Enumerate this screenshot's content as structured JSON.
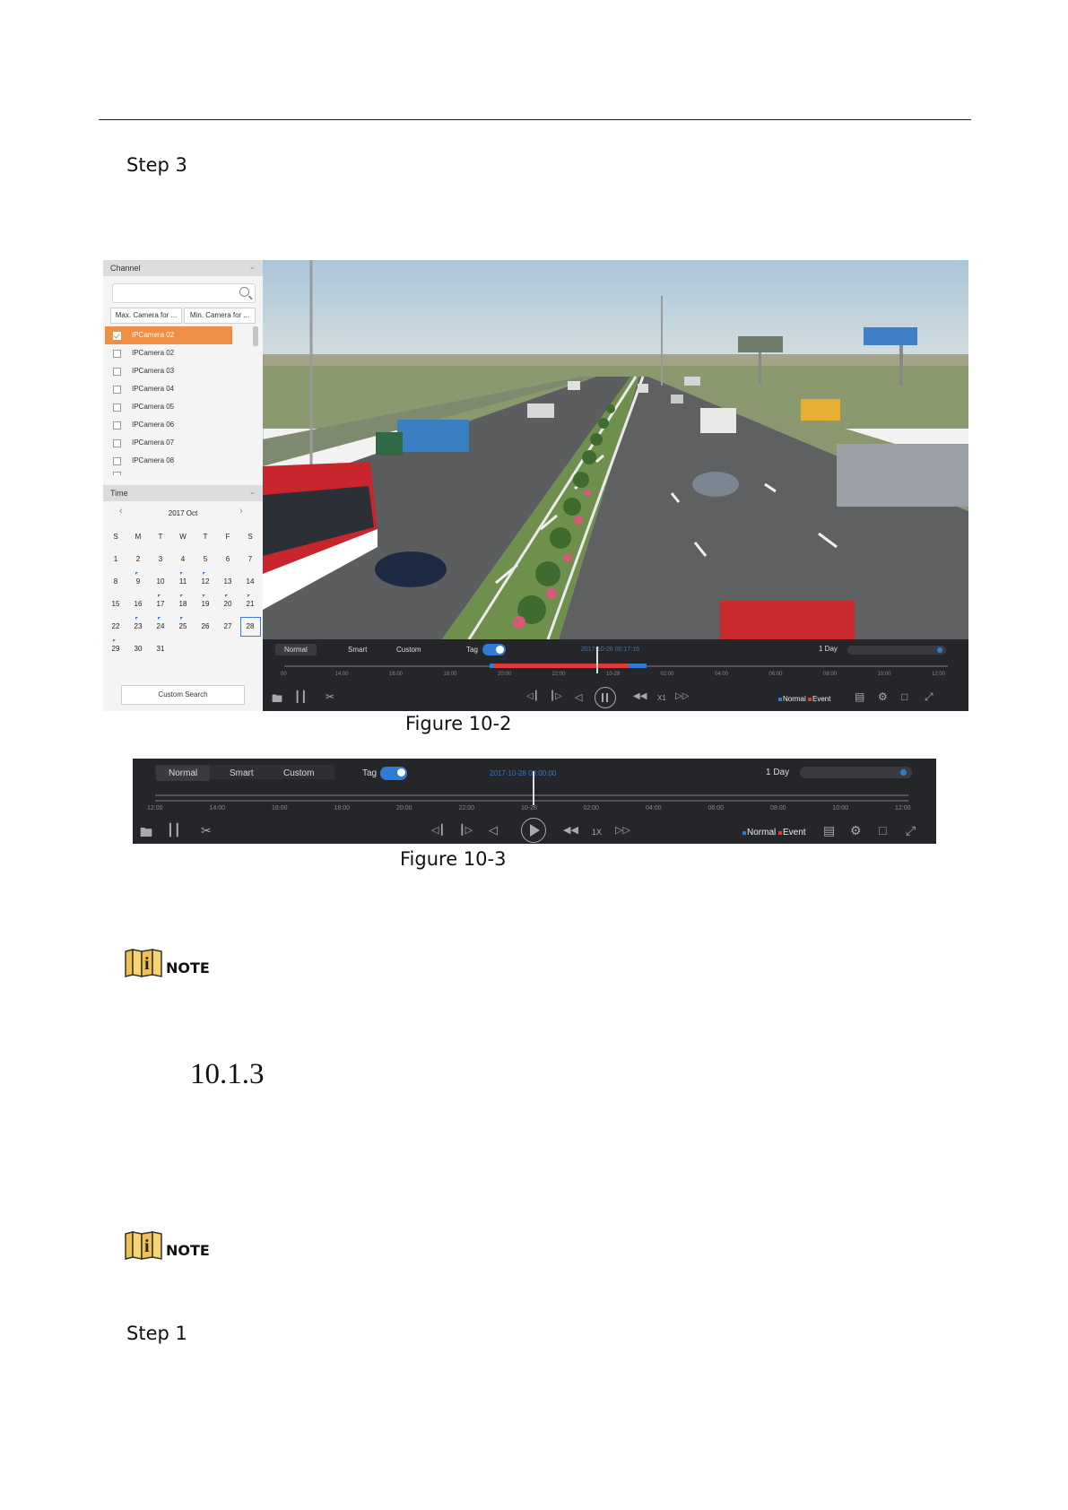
{
  "steps": {
    "step3": "Step 3",
    "step1": "Step 1"
  },
  "figure2": {
    "caption": "Figure 10-2",
    "channel": {
      "header": "Channel",
      "tab_max": "Max. Camera for ...",
      "tab_min": "Min. Camera for ...",
      "items": [
        "IPCamera 02",
        "IPCamera 02",
        "IPCamera 03",
        "IPCamera 04",
        "IPCamera 05",
        "IPCamera 06",
        "IPCamera 07",
        "IPCamera 08"
      ],
      "selected_index": 0
    },
    "time": {
      "header": "Time",
      "month": "2017 Oct",
      "weekdays": [
        "S",
        "M",
        "T",
        "W",
        "T",
        "F",
        "S"
      ],
      "days": [
        "1",
        "2",
        "3",
        "4",
        "5",
        "6",
        "7",
        "8",
        "9",
        "10",
        "11",
        "12",
        "13",
        "14",
        "15",
        "16",
        "17",
        "18",
        "19",
        "20",
        "21",
        "22",
        "23",
        "24",
        "25",
        "26",
        "27",
        "28",
        "29",
        "30",
        "31"
      ],
      "today": "28",
      "custom_search": "Custom Search"
    },
    "controls": {
      "tab_normal": "Normal",
      "tab_smart": "Smart",
      "tab_custom": "Custom",
      "tag_label": "Tag",
      "timestamp": "2017-10-28 00:17:16",
      "range": "1 Day",
      "ticks": [
        "00",
        "14:00",
        "16:00",
        "18:00",
        "20:00",
        "22:00",
        "10-28",
        "02:00",
        "04:00",
        "06:00",
        "08:00",
        "10:00",
        "12:00"
      ],
      "speed": "X1",
      "legend_normal": "Normal",
      "legend_event": "Event"
    }
  },
  "figure3": {
    "caption": "Figure 10-3",
    "controls": {
      "tab_normal": "Normal",
      "tab_smart": "Smart",
      "tab_custom": "Custom",
      "tag_label": "Tag",
      "timestamp": "2017-10-28 00:00:00",
      "range": "1 Day",
      "ticks": [
        "12:00",
        "14:00",
        "16:00",
        "18:00",
        "20:00",
        "22:00",
        "10-28",
        "02:00",
        "04:00",
        "06:00",
        "08:00",
        "10:00",
        "12:00"
      ],
      "speed": "1X",
      "legend_normal": "Normal",
      "legend_event": "Event"
    }
  },
  "notes": {
    "label1": "NOTE",
    "label2": "NOTE"
  },
  "section_heading": "10.1.3",
  "colors": {
    "accent": "#2f7bd6",
    "selected": "#ef8e45",
    "event": "#e03a3a",
    "bar": "#252629"
  }
}
